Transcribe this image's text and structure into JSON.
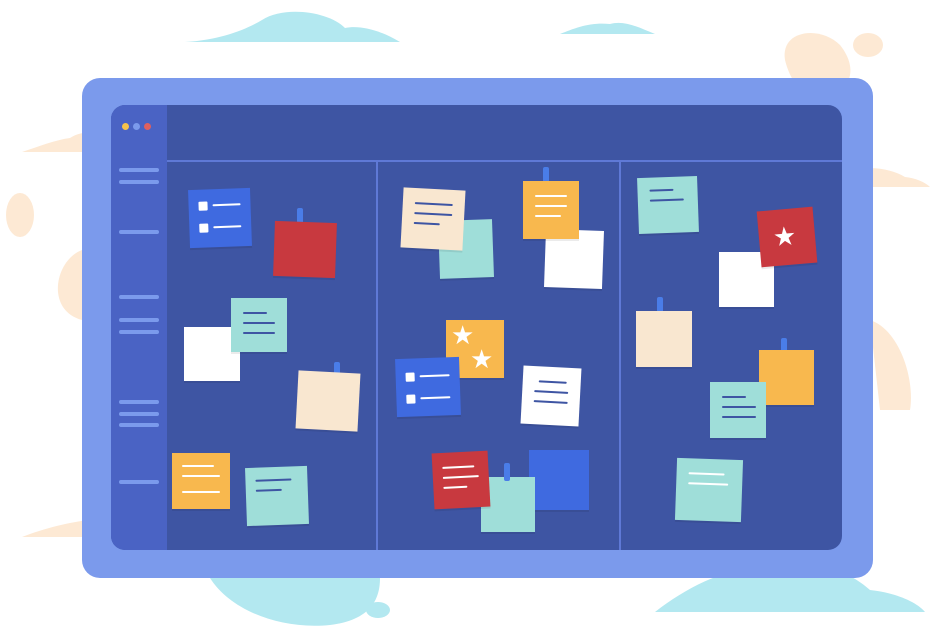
{
  "colors": {
    "background": "#ffffff",
    "frame": "#7b9aec",
    "screen": "#3e55a3",
    "sidebar": "#4a63c4",
    "divider": "#5f79d6",
    "cloud_blue": "#b3e8f0",
    "cloud_peach": "#fde9d4",
    "window_dots": [
      "#f6c24a",
      "#7b9aec",
      "#e0605e"
    ],
    "note_yellow": "#f8b84e",
    "note_teal": "#9fded9",
    "note_cream": "#f9e7d0",
    "note_white": "#ffffff",
    "note_blue": "#3f6ae0",
    "note_red": "#c8393f"
  },
  "board": {
    "columns": 3
  },
  "icons": [
    "window-dot-icon",
    "star-icon",
    "checkbox-icon",
    "pin-icon"
  ]
}
